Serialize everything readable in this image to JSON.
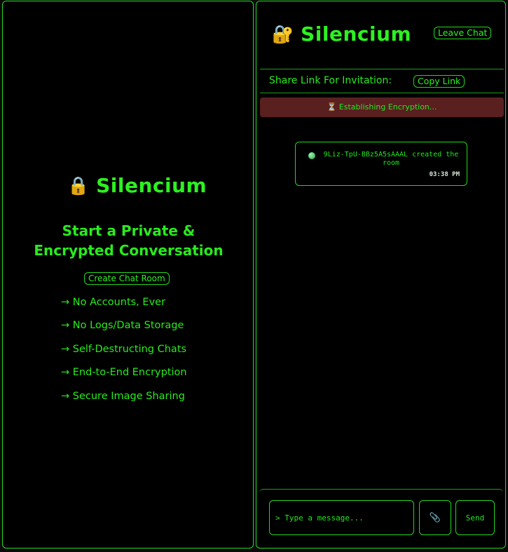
{
  "colors": {
    "accent": "#22e81e",
    "background": "#000000",
    "status_bg": "#5a1f1f"
  },
  "landing": {
    "brand_icon": "🔒",
    "brand_icon_name": "lock-icon",
    "brand_name": "Silencium",
    "tagline_line1": "Start a Private &",
    "tagline_line2": "Encrypted Conversation",
    "create_button": "Create Chat Room",
    "features": [
      "→ No Accounts, Ever",
      "→ No Logs/Data Storage",
      "→ Self-Destructing Chats",
      "→ End-to-End Encryption",
      "→ Secure Image Sharing"
    ]
  },
  "chat": {
    "brand_icon": "🔐",
    "brand_icon_name": "lock-with-key-icon",
    "brand_name": "Silencium",
    "leave_button": "Leave Chat",
    "share_label": "Share Link For Invitation:",
    "copy_button": "Copy Link",
    "status": "⏳ Establishing Encryption...",
    "messages": [
      {
        "text": "9Liz-TpU-BBz5A5sAAAL created the room",
        "time": "03:38 PM"
      }
    ],
    "input_placeholder": "> Type a message...",
    "attach_icon": "📎",
    "attach_icon_name": "paperclip-icon",
    "send_button": "Send"
  }
}
